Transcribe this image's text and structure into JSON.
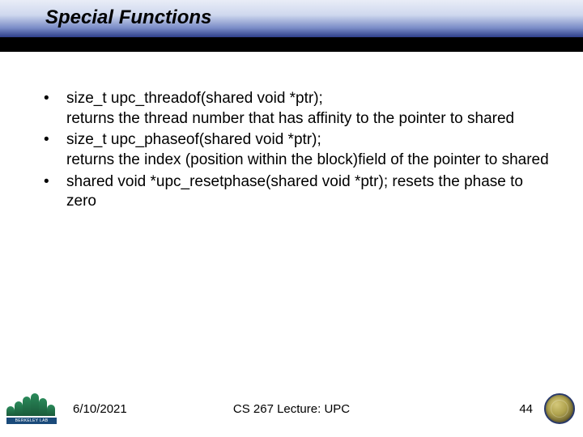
{
  "header": {
    "title": "Special Functions"
  },
  "bullets": [
    {
      "lines": [
        "size_t upc_threadof(shared void *ptr);",
        "returns the thread number that has affinity to the pointer to shared"
      ]
    },
    {
      "lines": [
        "size_t upc_phaseof(shared void *ptr);",
        "returns the index (position within the block)field of the pointer to shared"
      ]
    },
    {
      "lines": [
        "shared void *upc_resetphase(shared void *ptr); resets the phase to zero"
      ]
    }
  ],
  "footer": {
    "date": "6/10/2021",
    "center": "CS 267 Lecture: UPC",
    "page": "44",
    "logo_label": "BERKELEY LAB"
  }
}
